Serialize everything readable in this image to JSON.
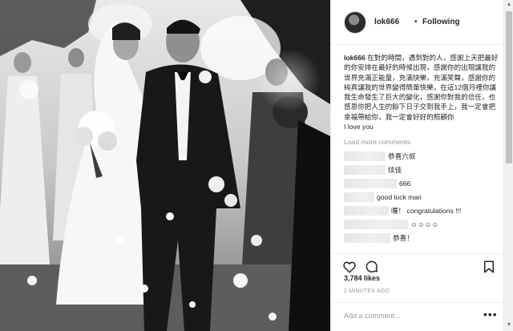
{
  "post": {
    "username": "lok666",
    "separator": "•",
    "follow_state": "Following",
    "caption_author": "lok666",
    "caption_text": "在對的時間，遇到對的人，感謝上天把最好的你安排在最好的時候出現，感謝你的出現讓我的世界充滿正能量，充滿快樂，充滿笑聲，感謝你的純真讓我的世界變得簡單快樂，在這12個月裡你讓我生命發生了巨大的變化，感謝你對我的信任，也感恩你把人生的餘下日子交到我手上，我一定會把幸福帶給你，我一定會好好的照顧你",
    "caption_tail": "I love you",
    "load_more": "Load more comments",
    "comments": [
      {
        "text": "恭喜六叔"
      },
      {
        "text": "炫佳"
      },
      {
        "text": "666"
      },
      {
        "text": "good luck man"
      },
      {
        "text": "囉！ congratulations !!!"
      },
      {
        "text": "☺☺☺☺"
      },
      {
        "text": "恭喜！"
      }
    ],
    "likes": "3,784 likes",
    "time": "2 MINUTES AGO",
    "add_comment_placeholder": "Add a comment...",
    "more_options": "•••"
  },
  "icons": {
    "like": "heart-icon",
    "comment": "comment-icon",
    "save": "bookmark-icon",
    "more": "more-options-icon"
  },
  "colors": {
    "text": "#262626",
    "muted": "#999999",
    "border": "#efefef"
  }
}
